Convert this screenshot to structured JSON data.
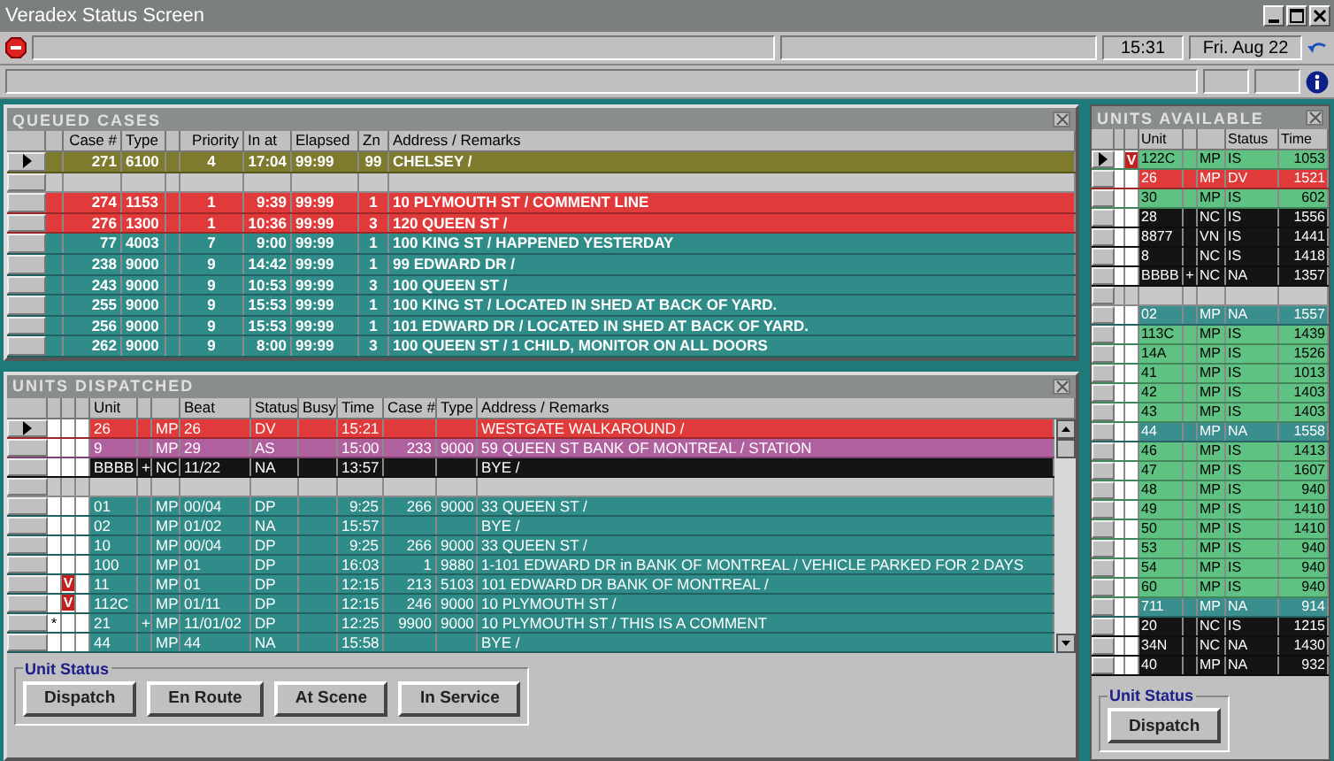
{
  "window": {
    "title": "Veradex Status Screen"
  },
  "toolbar": {
    "time": "15:31",
    "date": "Fri. Aug 22"
  },
  "queued_cases": {
    "title": "QUEUED CASES",
    "columns": [
      "Case #",
      "Type",
      "Priority",
      "In at",
      "Elapsed",
      "Zn",
      "Address / Remarks"
    ],
    "rows": [
      {
        "kind": "case",
        "current": true,
        "color": "#7e7b2f",
        "cells": [
          "271",
          "6100",
          "4",
          "17:04",
          "99:99",
          "99",
          "CHELSEY /"
        ]
      },
      {
        "kind": "separator",
        "current": false
      },
      {
        "kind": "case",
        "current": false,
        "color": "#e03a3a",
        "cells": [
          "274",
          "1153",
          "1",
          "9:39",
          "99:99",
          "1",
          "10 PLYMOUTH ST / COMMENT LINE"
        ]
      },
      {
        "kind": "case",
        "current": false,
        "color": "#e03a3a",
        "cells": [
          "276",
          "1300",
          "1",
          "10:36",
          "99:99",
          "3",
          "120 QUEEN ST /"
        ]
      },
      {
        "kind": "case",
        "current": false,
        "color": "#2f8c88",
        "cells": [
          "77",
          "4003",
          "7",
          "9:00",
          "99:99",
          "1",
          "100 KING ST / HAPPENED YESTERDAY"
        ]
      },
      {
        "kind": "case",
        "current": false,
        "color": "#2f8c88",
        "cells": [
          "238",
          "9000",
          "9",
          "14:42",
          "99:99",
          "1",
          "99 EDWARD DR /"
        ]
      },
      {
        "kind": "case",
        "current": false,
        "color": "#2f8c88",
        "cells": [
          "243",
          "9000",
          "9",
          "10:53",
          "99:99",
          "3",
          "100 QUEEN ST /"
        ]
      },
      {
        "kind": "case",
        "current": false,
        "color": "#2f8c88",
        "cells": [
          "255",
          "9000",
          "9",
          "15:53",
          "99:99",
          "1",
          "100 KING ST / LOCATED IN SHED AT BACK OF YARD."
        ]
      },
      {
        "kind": "case",
        "current": false,
        "color": "#2f8c88",
        "cells": [
          "256",
          "9000",
          "9",
          "15:53",
          "99:99",
          "1",
          "101 EDWARD DR / LOCATED IN SHED AT BACK OF YARD."
        ]
      },
      {
        "kind": "case",
        "current": false,
        "color": "#2f8c88",
        "cells": [
          "262",
          "9000",
          "9",
          "8:00",
          "99:99",
          "3",
          "100 QUEEN ST / 1 CHILD, MONITOR ON ALL DOORS"
        ]
      }
    ]
  },
  "units_dispatched": {
    "title": "UNITS DISPATCHED",
    "columns": [
      "Unit",
      "Beat",
      "Status",
      "Busy",
      "Time",
      "Case #",
      "Type",
      "Address / Remarks"
    ],
    "rows": [
      {
        "kind": "unit",
        "current": true,
        "color": "#e03a3a",
        "unit": "26",
        "agency": "MP",
        "beat": "26",
        "status": "DV",
        "time": "15:21",
        "address": "WESTGATE WALKAROUND /"
      },
      {
        "kind": "unit",
        "current": false,
        "color": "#b0609f",
        "unit": "9",
        "agency": "MP",
        "beat": "29",
        "status": "AS",
        "time": "15:00",
        "case": "233",
        "type": "9000",
        "address": "59 QUEEN ST BANK OF MONTREAL / STATION"
      },
      {
        "kind": "unit",
        "current": false,
        "color": "#141414",
        "unit": "BBBB",
        "plus": "+",
        "agency": "NC",
        "beat": "11/22",
        "status": "NA",
        "time": "13:57",
        "address": "BYE /"
      },
      {
        "kind": "separator",
        "current": false
      },
      {
        "kind": "unit",
        "current": false,
        "color": "#2f8c88",
        "unit": "01",
        "agency": "MP",
        "beat": "00/04",
        "status": "DP",
        "time": "9:25",
        "case": "266",
        "type": "9000",
        "address": "33 QUEEN ST /"
      },
      {
        "kind": "unit",
        "current": false,
        "color": "#2f8c88",
        "unit": "02",
        "agency": "MP",
        "beat": "01/02",
        "status": "NA",
        "time": "15:57",
        "address": "BYE /"
      },
      {
        "kind": "unit",
        "current": false,
        "color": "#2f8c88",
        "unit": "10",
        "agency": "MP",
        "beat": "00/04",
        "status": "DP",
        "time": "9:25",
        "case": "266",
        "type": "9000",
        "address": "33 QUEEN ST /"
      },
      {
        "kind": "unit",
        "current": false,
        "color": "#2f8c88",
        "unit": "100",
        "agency": "MP",
        "beat": "01",
        "status": "DP",
        "time": "16:03",
        "case": "1",
        "type": "9880",
        "address": "1-101 EDWARD DR in BANK OF MONTREAL / VEHICLE PARKED FOR 2 DAYS"
      },
      {
        "kind": "unit",
        "current": false,
        "color": "#2f8c88",
        "flag": "V",
        "unit": "11",
        "agency": "MP",
        "beat": "01",
        "status": "DP",
        "time": "12:15",
        "case": "213",
        "type": "5103",
        "address": "101 EDWARD DR BANK OF MONTREAL /"
      },
      {
        "kind": "unit",
        "current": false,
        "color": "#2f8c88",
        "flag": "V",
        "unit": "112C",
        "agency": "MP",
        "beat": "01/11",
        "status": "DP",
        "time": "12:15",
        "case": "246",
        "type": "9000",
        "address": "10 PLYMOUTH ST /"
      },
      {
        "kind": "unit",
        "current": false,
        "color": "#2f8c88",
        "marker": "*",
        "unit": "21",
        "plus": "+",
        "agency": "MP",
        "beat": "11/01/02",
        "status": "DP",
        "time": "12:25",
        "case": "9900",
        "type": "9000",
        "address": "10 PLYMOUTH ST / THIS IS A COMMENT"
      },
      {
        "kind": "unit",
        "current": false,
        "color": "#2f8c88",
        "unit": "44",
        "agency": "MP",
        "beat": "44",
        "status": "NA",
        "time": "15:58",
        "address": "BYE /"
      }
    ],
    "unit_status": {
      "legend": "Unit Status",
      "buttons": [
        "Dispatch",
        "En Route",
        "At Scene",
        "In Service"
      ]
    }
  },
  "units_available": {
    "title": "UNITS AVAILABLE",
    "columns": [
      "Unit",
      "Status",
      "Time"
    ],
    "rows": [
      {
        "kind": "unit",
        "current": true,
        "color": "#5fc283",
        "flag": "V",
        "unit": "122C",
        "agency": "MP",
        "status": "IS",
        "time": "1053"
      },
      {
        "kind": "unit",
        "current": false,
        "color": "#e03a3a",
        "unit": "26",
        "agency": "MP",
        "status": "DV",
        "time": "1521"
      },
      {
        "kind": "unit",
        "current": false,
        "color": "#5fc283",
        "unit": "30",
        "agency": "MP",
        "status": "IS",
        "time": "602"
      },
      {
        "kind": "unit",
        "current": false,
        "color": "#141414",
        "unit": "28",
        "agency": "NC",
        "status": "IS",
        "time": "1556"
      },
      {
        "kind": "unit",
        "current": false,
        "color": "#141414",
        "unit": "8877",
        "agency": "VN",
        "status": "IS",
        "time": "1441"
      },
      {
        "kind": "unit",
        "current": false,
        "color": "#141414",
        "unit": "8",
        "agency": "NC",
        "status": "IS",
        "time": "1418"
      },
      {
        "kind": "unit",
        "current": false,
        "color": "#141414",
        "unit": "BBBB",
        "plus": "+",
        "agency": "NC",
        "status": "NA",
        "time": "1357"
      },
      {
        "kind": "separator",
        "current": false
      },
      {
        "kind": "unit",
        "current": false,
        "color": "#3a8e8e",
        "unit": "02",
        "agency": "MP",
        "status": "NA",
        "time": "1557"
      },
      {
        "kind": "unit",
        "current": false,
        "color": "#5fc283",
        "unit": "113C",
        "agency": "MP",
        "status": "IS",
        "time": "1439"
      },
      {
        "kind": "unit",
        "current": false,
        "color": "#5fc283",
        "unit": "14A",
        "agency": "MP",
        "status": "IS",
        "time": "1526"
      },
      {
        "kind": "unit",
        "current": false,
        "color": "#5fc283",
        "unit": "41",
        "agency": "MP",
        "status": "IS",
        "time": "1013"
      },
      {
        "kind": "unit",
        "current": false,
        "color": "#5fc283",
        "unit": "42",
        "agency": "MP",
        "status": "IS",
        "time": "1403"
      },
      {
        "kind": "unit",
        "current": false,
        "color": "#5fc283",
        "unit": "43",
        "agency": "MP",
        "status": "IS",
        "time": "1403"
      },
      {
        "kind": "unit",
        "current": false,
        "color": "#3a8e8e",
        "unit": "44",
        "agency": "MP",
        "status": "NA",
        "time": "1558"
      },
      {
        "kind": "unit",
        "current": false,
        "color": "#5fc283",
        "unit": "46",
        "agency": "MP",
        "status": "IS",
        "time": "1413"
      },
      {
        "kind": "unit",
        "current": false,
        "color": "#5fc283",
        "unit": "47",
        "agency": "MP",
        "status": "IS",
        "time": "1607"
      },
      {
        "kind": "unit",
        "current": false,
        "color": "#5fc283",
        "unit": "48",
        "agency": "MP",
        "status": "IS",
        "time": "940"
      },
      {
        "kind": "unit",
        "current": false,
        "color": "#5fc283",
        "unit": "49",
        "agency": "MP",
        "status": "IS",
        "time": "1410"
      },
      {
        "kind": "unit",
        "current": false,
        "color": "#5fc283",
        "unit": "50",
        "agency": "MP",
        "status": "IS",
        "time": "1410"
      },
      {
        "kind": "unit",
        "current": false,
        "color": "#5fc283",
        "unit": "53",
        "agency": "MP",
        "status": "IS",
        "time": "940"
      },
      {
        "kind": "unit",
        "current": false,
        "color": "#5fc283",
        "unit": "54",
        "agency": "MP",
        "status": "IS",
        "time": "940"
      },
      {
        "kind": "unit",
        "current": false,
        "color": "#5fc283",
        "unit": "60",
        "agency": "MP",
        "status": "IS",
        "time": "940"
      },
      {
        "kind": "unit",
        "current": false,
        "color": "#3a8e8e",
        "unit": "711",
        "agency": "MP",
        "status": "NA",
        "time": "914"
      },
      {
        "kind": "unit",
        "current": false,
        "color": "#141414",
        "unit": "20",
        "agency": "NC",
        "status": "IS",
        "time": "1215"
      },
      {
        "kind": "unit",
        "current": false,
        "color": "#141414",
        "unit": "34N",
        "agency": "NC",
        "status": "NA",
        "time": "1430"
      },
      {
        "kind": "unit",
        "current": false,
        "color": "#141414",
        "unit": "40",
        "agency": "MP",
        "status": "NA",
        "time": "932"
      }
    ],
    "unit_status": {
      "legend": "Unit Status",
      "buttons": [
        "Dispatch"
      ]
    }
  }
}
